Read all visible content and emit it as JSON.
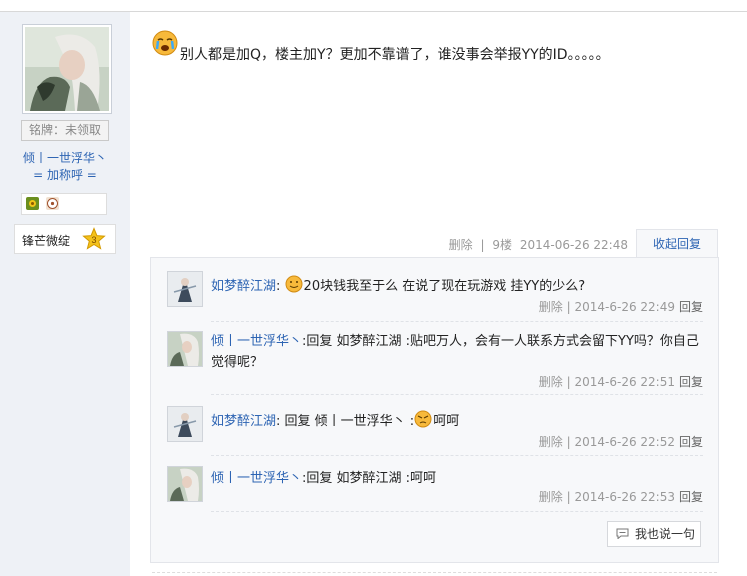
{
  "user": {
    "avatar_icon": "user-avatar",
    "badge_label": "铭牌：未领取",
    "name_line1": "倾丨一世浮华丶",
    "name_line2": "= 加称呼 =",
    "icons": [
      "flower-icon",
      "football-icon"
    ],
    "level_name": "锋芒微绽",
    "level_number": "3"
  },
  "post": {
    "emoji": "crying-emoji",
    "text": "别人都是加Q，楼主加Y？更加不靠谱了，谁没事会举报YY的ID。。。。。",
    "delete_label": "删除",
    "floor": "9楼",
    "timestamp": "2014-06-26 22:48",
    "collapse_label": "收起回复"
  },
  "replies": [
    {
      "author": "如梦醉江湖",
      "colon": ":",
      "emoji": "smile-emoji",
      "text": "20块钱我至于么 在说了现在玩游戏 挂YY的少么?",
      "delete_label": "删除",
      "time": "2014-6-26 22:49",
      "reply_label": "回复"
    },
    {
      "author": "倾丨一世浮华丶",
      "colon": ":",
      "text": "回复 如梦醉江湖 :贴吧万人，会有一人联系方式会留下YY吗？你自己觉得呢？",
      "delete_label": "删除",
      "time": "2014-6-26 22:51",
      "reply_label": "回复"
    },
    {
      "author": "如梦醉江湖",
      "colon": ":",
      "text_before": "回复 倾丨一世浮华丶 :",
      "emoji": "angry-emoji",
      "text_after": "呵呵",
      "delete_label": "删除",
      "time": "2014-6-26 22:52",
      "reply_label": "回复"
    },
    {
      "author": "倾丨一世浮华丶",
      "colon": ":",
      "text": "回复 如梦醉江湖 :呵呵",
      "delete_label": "删除",
      "time": "2014-6-26 22:53",
      "reply_label": "回复"
    }
  ],
  "say_button_label": "我也说一句",
  "colors": {
    "link": "#2d64b3",
    "left_column_bg": "#eef1f6",
    "reply_panel_bg": "#f7f8fa"
  }
}
